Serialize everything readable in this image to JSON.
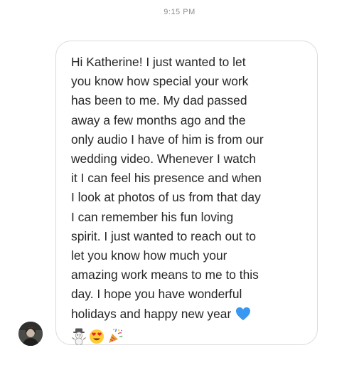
{
  "thread": {
    "timestamp": "9:15 PM"
  },
  "message": {
    "lines": [
      "Hi Katherine! I just wanted to let",
      "you know how special your work",
      "has been to me. My dad passed",
      "away a few months ago and the",
      "only audio I have of him is from our",
      "wedding video. Whenever I watch",
      "it I can feel his presence and when",
      "I look at photos of us from that day",
      "I can remember his fun loving",
      "spirit. I just wanted to reach out to",
      "let you know how much your",
      "amazing work means to me to this",
      "day. I hope you have wonderful",
      "holidays and happy new year"
    ],
    "end_emoji": "blue-heart-icon",
    "trailing_emojis": [
      "snowman-icon",
      "heart-eyes-icon",
      "party-popper-icon"
    ]
  },
  "sender": {
    "avatar": "avatar"
  },
  "colors": {
    "text": "#262626",
    "timestamp": "#8e8e8e",
    "bubble_border": "#dbdbdb",
    "heart": "#3897f0"
  }
}
